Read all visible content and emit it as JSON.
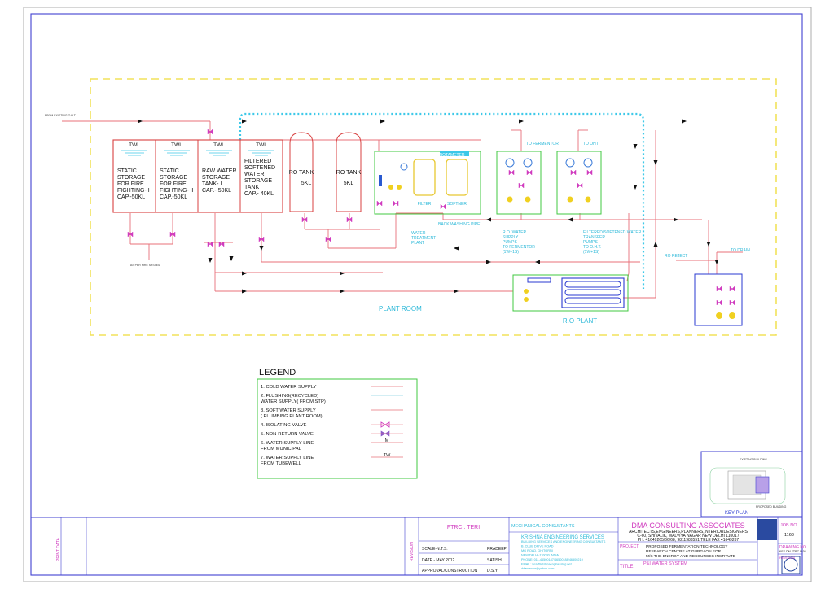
{
  "source_label": "FROM EXISTING O.H.T.",
  "tanks": [
    {
      "head": "TWL",
      "lines": [
        "STATIC",
        "STORAGE",
        "FOR FIRE",
        "FIGHTING- I",
        "CAP.-50KL"
      ]
    },
    {
      "head": "TWL",
      "lines": [
        "STATIC",
        "STORAGE",
        "FOR FIRE",
        "FIGHTING- II",
        "CAP.-50KL"
      ]
    },
    {
      "head": "TWL",
      "lines": [
        "RAW WATER",
        "STORAGE",
        "TANK- I",
        "CAP.- 50KL"
      ]
    },
    {
      "head": "TWL",
      "lines": [
        "FILTERED",
        "SOFTENED",
        "WATER",
        "STORAGE",
        "TANK",
        "CAP.- 40KL"
      ]
    }
  ],
  "ro_tanks": [
    {
      "lines": [
        "RO TANK",
        "5KL"
      ]
    },
    {
      "lines": [
        "RO TANK",
        "5KL"
      ]
    }
  ],
  "labels": {
    "to_fire_system": "AS PER FIRE SYSTEM",
    "rotameter": "ROTAMETER",
    "filter": "FILTER",
    "softner": "SOFTNER",
    "back_washing": "BACK WASHING PIPE",
    "wtp": [
      "WATER",
      "TREATMENT",
      "PLANT"
    ],
    "to_fermentor": "TO FERMENTOR",
    "to_oht": "TO OHT",
    "ro_supply": [
      "R.O. WATER",
      "SUPPLY",
      "PUMPS",
      "TO FERMENTOR",
      "(1W+1S)"
    ],
    "filtered_transfer": [
      "FILTERED/SOFTENED WATER",
      "TRANSFER",
      "PUMPS",
      "TO O.H.T.",
      "(1W+1S)"
    ],
    "ro_reject": "RO REJECT",
    "to_drain": "TO DRAIN",
    "plant_room": "PLANT ROOM",
    "ro_plant": "R.O PLANT"
  },
  "legend": {
    "title": "LEGEND",
    "items": [
      {
        "lines": [
          "1. COLD WATER SUPPLY"
        ],
        "symbol": "",
        "color": "#e8707a"
      },
      {
        "lines": [
          "2. FLUSHING(RECYCLED)",
          "WATER SUPPLY( FROM STP)"
        ],
        "symbol": "",
        "color": "#8ad0e0"
      },
      {
        "lines": [
          "3. SOFT WATER SUPPLY",
          "( PLUMBING PLANT ROOM)"
        ],
        "symbol": "",
        "color": "#e8707a"
      },
      {
        "lines": [
          "4. ISOLATING VALVE"
        ],
        "symbol": "",
        "color": "#d03cbf"
      },
      {
        "lines": [
          "5. NON-RETURN VALVE"
        ],
        "symbol": "",
        "color": "#8a5ac8"
      },
      {
        "lines": [
          "6. WATER SUPPLY LINE",
          "FROM MUNICIPAL"
        ],
        "symbol": "M",
        "color": "#e8707a"
      },
      {
        "lines": [
          "7. WATER SUPPLY LINE",
          "FROM TUBEWELL"
        ],
        "symbol": "TW",
        "color": "#e8707a"
      }
    ]
  },
  "key_plan": {
    "title": "KEY PLAN",
    "existing": "EXISTING BUILDING",
    "proposed": "PROPOSED BUILDING"
  },
  "title_block": {
    "print_data": "PRINT DATA",
    "project_code": "FTRC : TERI",
    "revision": "REVISION",
    "scale": "SCALE-N.T.S.",
    "date": "DATE - MAY 2012",
    "approval": "APPROVAL/CONSTRUCTION",
    "drawn_by": "PRADEEP",
    "checked_by": "SATISH",
    "approved_by": "D.S.Y",
    "mech_consultants": "MECHANICAL CONSULTANTS",
    "consultant_name": "KRISHNA ENGINEERING SERVICES",
    "consultant_lines": [
      "BUILDING SERVICES AND ENGINEERING CONSULTANTS",
      "B. CLUB DRIVE ROAD",
      "MG ROAD, GHITORNI",
      "NEW DELHI-110030,INDIA",
      "PHONE: 011-46500187/46500188/46500219",
      "EMAIL: kes@krishnaengineering.net",
      "ddamanna@yahoo.com"
    ],
    "architect": "DMA CONSULTING ASSOCIATES",
    "architect_lines": [
      "ARCHITECTS,ENGINEERS,PLANNERS,INTERIORDESIGNERS",
      "C-60, SHIVALIK, MALVIYA NAGAR NEW DELHI 110017",
      "PH. 41649265/66/68, 9811983551 TELE FAX 41649267"
    ],
    "project_label": "PROJECT:",
    "project_lines": [
      "PROPOSED FERMENTATION TECHNOLOGY",
      "RESEARCH CENTRE AT GURGAON FOR",
      "M/S THE ENERGY AND RESOURCES INSTITUTE"
    ],
    "title_label": "TITLE:",
    "title": "P&I WATER SYSTEM",
    "job_label": "JOB NO.",
    "job_no": "1168",
    "drawing_label": "DRAWING NO.",
    "drawing_no": "KES-DM-FTRC-P-06",
    "revision_label": "REVISION"
  }
}
